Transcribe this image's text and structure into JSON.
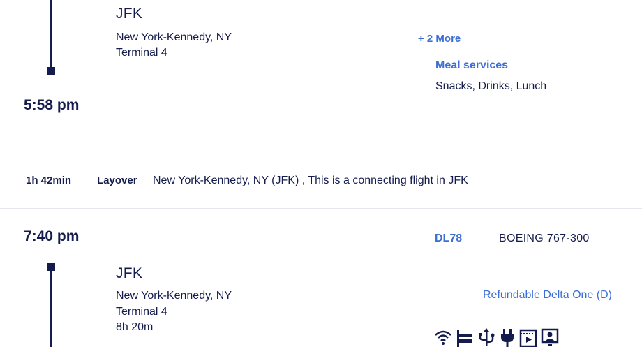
{
  "segment1_arrival": {
    "airport_code": "JFK",
    "city": "New York-Kennedy, NY",
    "terminal": "Terminal 4",
    "time": "5:58 pm"
  },
  "services": {
    "more_link": "+ 2 More",
    "meal_label": "Meal services",
    "meal_value": "Snacks, Drinks, Lunch"
  },
  "layover": {
    "duration": "1h 42min",
    "label": "Layover",
    "text": "New York-Kennedy, NY (JFK) , This is a connecting flight in JFK"
  },
  "segment2_departure": {
    "time": "7:40 pm",
    "flight_number": "DL78",
    "aircraft": "BOEING 767-300",
    "airport_code": "JFK",
    "city": "New York-Kennedy, NY",
    "terminal": "Terminal 4",
    "duration": "8h 20m",
    "fare_class": "Refundable Delta One (D)"
  },
  "amenity_icons": [
    "wifi-icon",
    "flat-bed-seat-icon",
    "usb-power-icon",
    "power-outlet-icon",
    "entertainment-screen-icon",
    "personal-video-icon"
  ],
  "colors": {
    "navy": "#141b4d",
    "link_blue": "#3c6fd4",
    "divider": "#e6e8ee"
  }
}
